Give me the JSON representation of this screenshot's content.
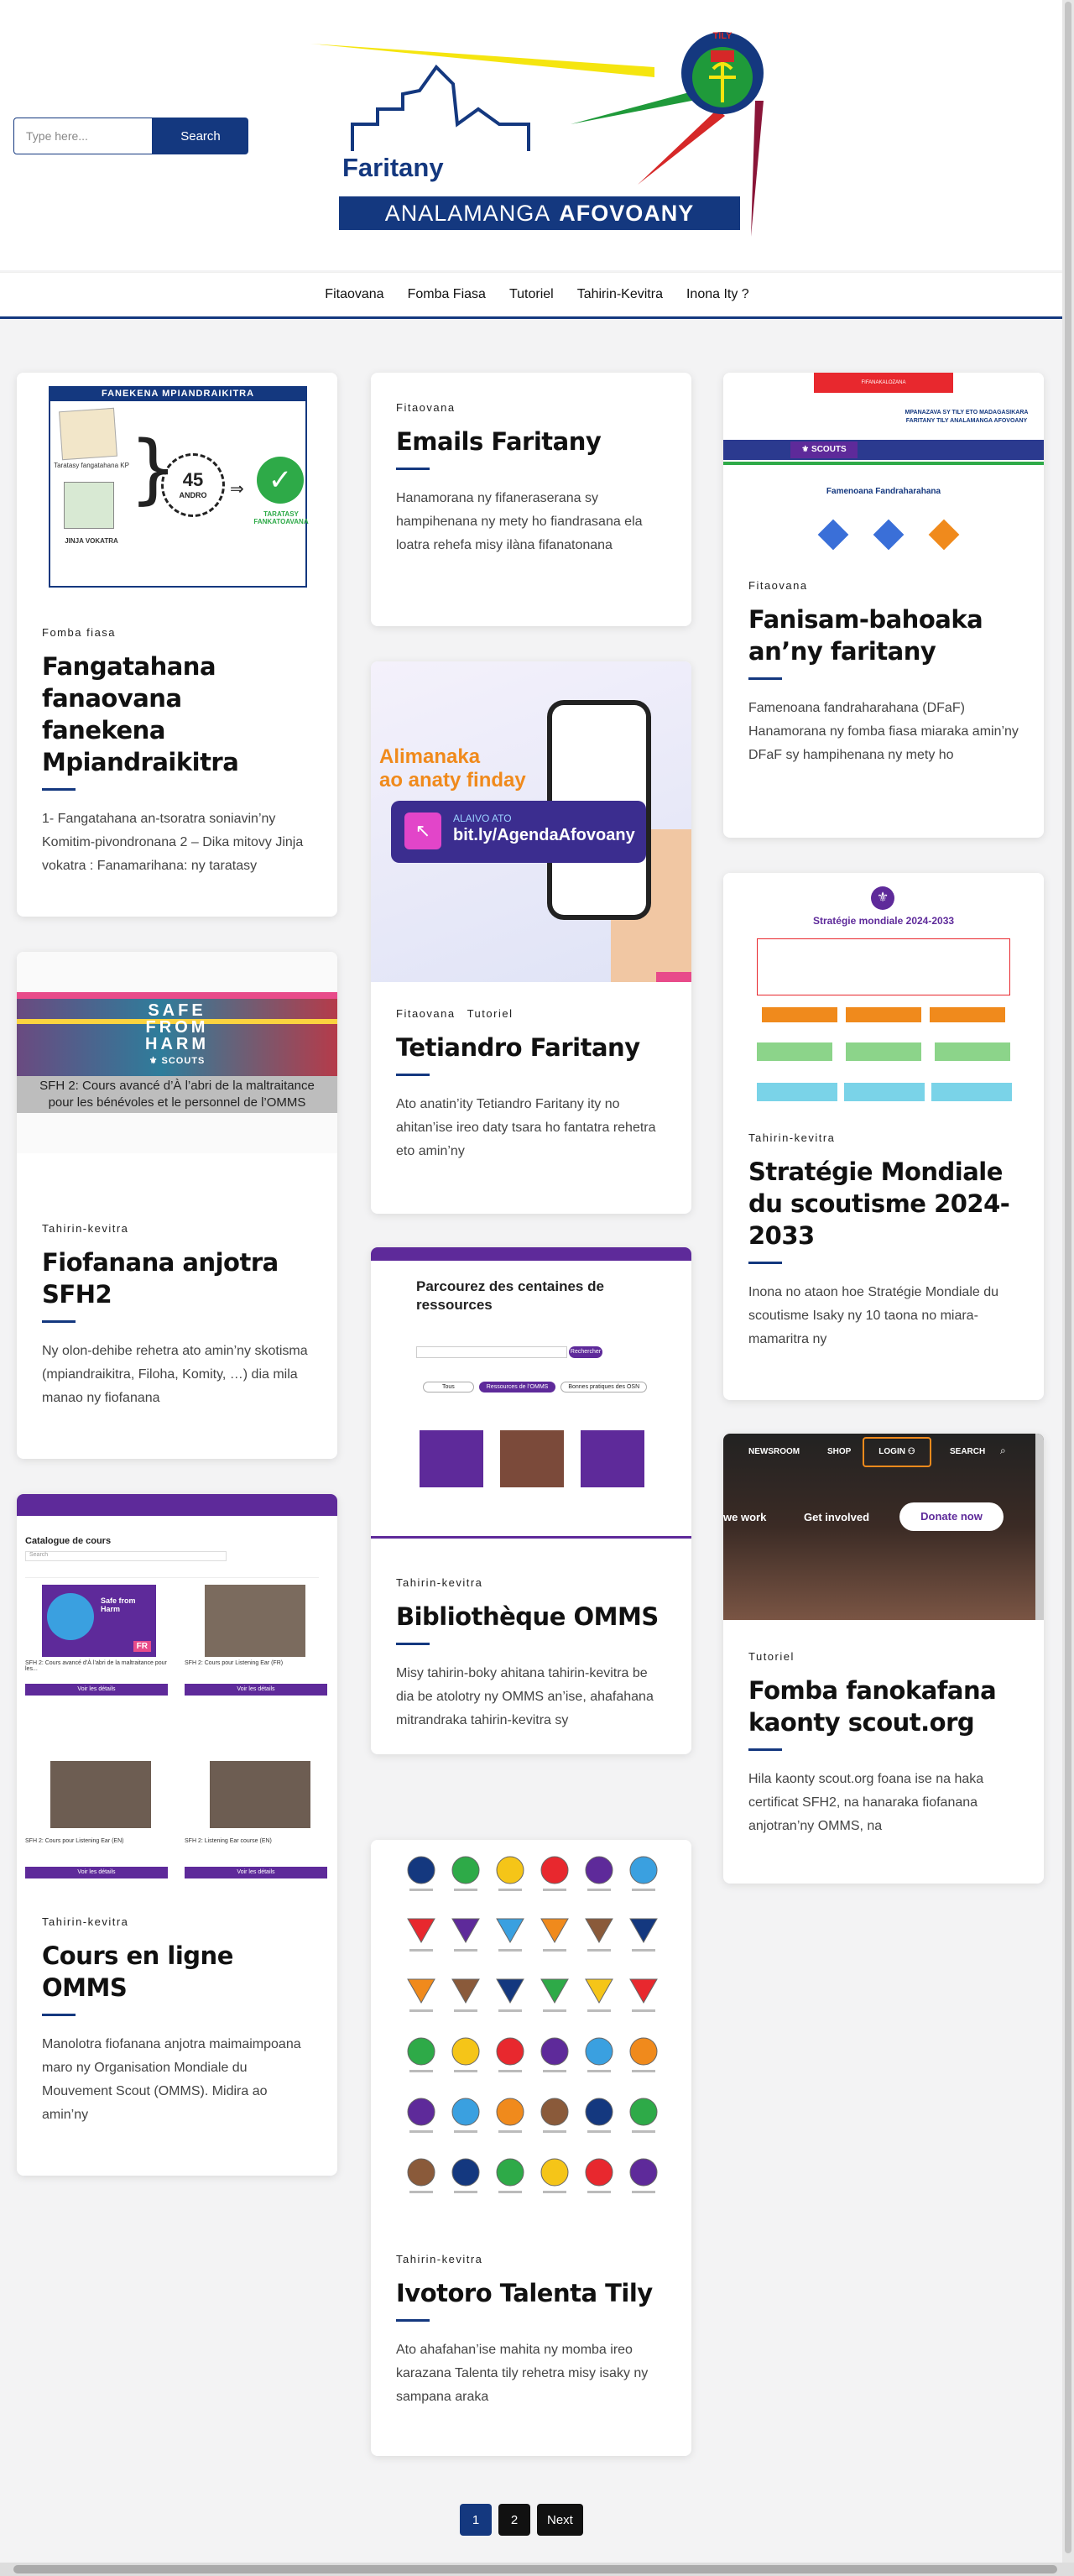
{
  "search": {
    "placeholder": "Type here...",
    "button_label": "Search"
  },
  "logo": {
    "title": "Faritany",
    "subtitle_1": "ANALAMANGA",
    "subtitle_2": "AFOVOANY",
    "badge": "TILY"
  },
  "nav": [
    {
      "label": "Fitaovana"
    },
    {
      "label": "Fomba Fiasa"
    },
    {
      "label": "Tutoriel"
    },
    {
      "label": "Tahirin-Kevitra"
    },
    {
      "label": "Inona Ity ?"
    }
  ],
  "posts": [
    {
      "categories": [
        "Fomba fiasa"
      ],
      "title": "Fangatahana fanaovana fanekena Mpiandraikitra",
      "excerpt": "1- Fangatahana an-tsoratra soniavin’ny Komitim-pivondronana 2 – Dika mitovy Jinja vokatra : Fanamarihana: ny taratasy",
      "image": {
        "banner": "FANEKENA MPIANDRAIKITRA",
        "number": "45",
        "number_label": "ANDRO",
        "check_label": "TARATASY FANKATOAVANA",
        "left_label_1": "Taratasy fangatahana KP",
        "left_label_2": "JINJA VOKATRA"
      }
    },
    {
      "categories": [
        "Tahirin-kevitra"
      ],
      "title": "Fiofanana anjotra SFH2",
      "excerpt": "Ny olon-dehibe rehetra ato amin’ny skotisma (mpiandraikitra, Filoha, Komity, …) dia mila manao ny fiofanana",
      "image": {
        "line_1": "SAFE",
        "line_2": "FROM",
        "line_3": "HARM",
        "brand": "SCOUTS",
        "caption_1": "SFH 2: Cours avancé d’À l’abri de la maltraitance",
        "caption_2": "pour les bénévoles et le personnel de l’OMMS"
      }
    },
    {
      "categories": [
        "Tahirin-kevitra"
      ],
      "title": "Cours en ligne OMMS",
      "excerpt": "Manolotra fiofanana anjotra maimaimpoana maro ny Organisation Mondiale du Mouvement Scout (OMMS). Midira ao amin’ny",
      "image": {
        "heading": "Catalogue de cours",
        "search": "Search",
        "badge_1": "Safe from Harm",
        "badge_2": "FR",
        "card_1": "SFH 2: Cours avancé d’À l’abri de la maltraitance pour les...",
        "card_2": "SFH 2: Cours pour Listening Ear (FR)",
        "card_3": "SFH 2: Cours pour Listening Ear (EN)",
        "card_4": "SFH 2: Listening Ear course (EN)",
        "btn": "Voir les détails"
      }
    },
    {
      "categories": [
        "Fitaovana"
      ],
      "title": "Emails Faritany",
      "excerpt": "Hanamorana ny fifaneraserana sy hampihenana ny mety ho fiandrasana ela loatra rehefa misy ilàna fifanatonana"
    },
    {
      "categories": [
        "Fitaovana",
        "Tutoriel"
      ],
      "title": "Tetiandro Faritany",
      "excerpt": "Ato anatin’ity Tetiandro Faritany ity no ahitan’ise ireo daty tsara ho fantatra rehetra eto amin’ny",
      "image": {
        "heading_1": "Alimanaka",
        "heading_2": "ao anaty finday",
        "pill_1": "ALAIVO ATO",
        "pill_2": "bit.ly/AgendaAfovoany"
      }
    },
    {
      "categories": [
        "Tahirin-kevitra"
      ],
      "title": "Bibliothèque OMMS",
      "excerpt": "Misy tahirin-boky ahitana tahirin-kevitra be dia be atolotry ny OMMS an’ise, ahafahana mitrandraka tahirin-kevitra sy",
      "image": {
        "heading": "Parcourez des centaines de ressources",
        "btn": "Rechercher",
        "tab_1": "Tous",
        "tab_2": "Ressources de l’OMMS",
        "tab_3": "Bonnes pratiques des OSN"
      }
    },
    {
      "categories": [
        "Tahirin-kevitra"
      ],
      "title": "Ivotoro Talenta Tily",
      "excerpt": "Ato ahafahan’ise mahita ny momba ireo karazana Talenta tily rehetra misy isaky ny sampana araka"
    },
    {
      "categories": [
        "Fitaovana"
      ],
      "title": "Fanisam-bahoaka an’ny faritany",
      "excerpt": "Famenoana fandraharahana (DFaF) Hanamorana ny fomba fiasa miaraka amin’ny DFaF sy hampihenana ny mety ho",
      "image": {
        "top": "FIFANAKALOZANA",
        "line_1": "MPANAZAVA SY TILY ETO MADAGASIKARA",
        "line_2": "FARITANY TILY ANALAMANGA AFOVOANY",
        "brand": "SCOUTS",
        "heading": "Famenoana Fandraharahana"
      }
    },
    {
      "categories": [
        "Tahirin-kevitra"
      ],
      "title": "Stratégie Mondiale du scoutisme 2024-2033",
      "excerpt": "Inona no ataon hoe Stratégie Mondiale du scoutisme Isaky ny 10 taona no miara-mamaritra ny",
      "image": {
        "heading": "Stratégie mondiale 2024-2033"
      }
    },
    {
      "categories": [
        "Tutoriel"
      ],
      "title": "Fomba fanokafana kaonty scout.org",
      "excerpt": "Hila kaonty scout.org foana ise na haka certificat SFH2, na hanaraka fiofanana anjotran’ny OMMS, na",
      "image": {
        "menu_1": "NEWSROOM",
        "menu_2": "SHOP",
        "menu_3": "LOGIN",
        "menu_4": "SEARCH",
        "link_1": "we work",
        "link_2": "Get involved",
        "btn": "Donate now"
      }
    }
  ],
  "pagination": {
    "pages": [
      "1",
      "2"
    ],
    "next": "Next",
    "current": "1"
  },
  "colors": {
    "brand_blue": "#14387f",
    "scout_purple": "#5e2a9a",
    "accent_red": "#c62828",
    "accent_yellow": "#f5e50f"
  }
}
